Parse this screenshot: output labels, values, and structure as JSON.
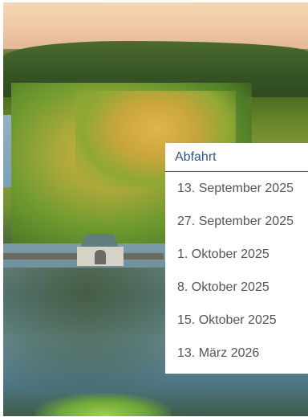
{
  "departures": {
    "title": "Abfahrt",
    "dates": [
      "13. September 2025",
      "27. September 2025",
      "1. Oktober 2025",
      "8. Oktober 2025",
      "15. Oktober 2025",
      "13. März 2026"
    ]
  },
  "colors": {
    "title": "#2f5690",
    "divider": "#3d5677",
    "date_text": "#555555",
    "panel_bg": "#ffffff"
  }
}
